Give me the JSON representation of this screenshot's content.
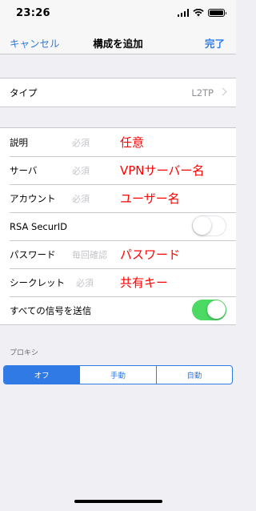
{
  "status_bar": {
    "time": "23:26",
    "icons": [
      "signal-icon",
      "wifi-icon",
      "battery-icon"
    ]
  },
  "nav": {
    "cancel_label": "キャンセル",
    "title": "構成を追加",
    "done_label": "完了"
  },
  "type_row": {
    "label": "タイプ",
    "value": "L2TP"
  },
  "fields": [
    {
      "label": "説明",
      "placeholder": "必須",
      "annotation": "任意"
    },
    {
      "label": "サーバ",
      "placeholder": "必須",
      "annotation": "VPNサーバー名"
    },
    {
      "label": "アカウント",
      "placeholder": "必須",
      "annotation": "ユーザー名"
    },
    {
      "label": "RSA SecurID",
      "switch_on": false
    },
    {
      "label": "パスワード",
      "placeholder": "毎回確認",
      "annotation": "パスワード"
    },
    {
      "label": "シークレット",
      "placeholder": "必須",
      "annotation": "共有キー"
    },
    {
      "label": "すべての信号を送信",
      "switch_on": true
    }
  ],
  "proxy": {
    "section_label": "プロキシ",
    "segments": [
      "オフ",
      "手動",
      "自動"
    ],
    "selected": "オフ"
  },
  "colors": {
    "accent": "#2f7ae5",
    "annotation": "#ff0000",
    "switch_on": "#4cd964",
    "background": "#efeff4"
  }
}
